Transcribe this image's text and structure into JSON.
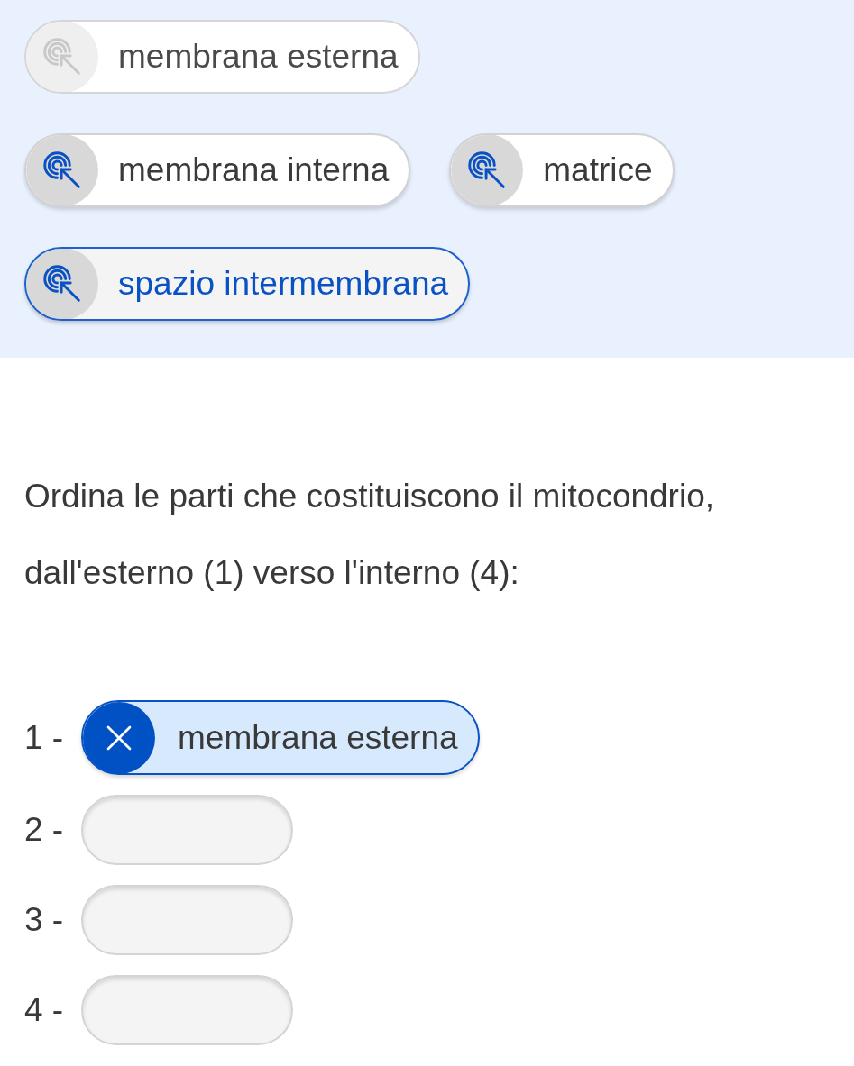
{
  "choices": [
    {
      "label": "membrana esterna",
      "disabled": true,
      "selected": false
    },
    {
      "label": "membrana interna",
      "disabled": false,
      "selected": false
    },
    {
      "label": "matrice",
      "disabled": false,
      "selected": false
    },
    {
      "label": "spazio intermembrana",
      "disabled": false,
      "selected": true
    }
  ],
  "instruction": [
    "Ordina le parti che costituiscono il mitocondrio,",
    "dall'esterno (1) verso l'interno (4):"
  ],
  "slots": [
    {
      "number": "1 -",
      "answer": "membrana esterna"
    },
    {
      "number": "2 -"
    },
    {
      "number": "3 -"
    },
    {
      "number": "4 -"
    }
  ]
}
